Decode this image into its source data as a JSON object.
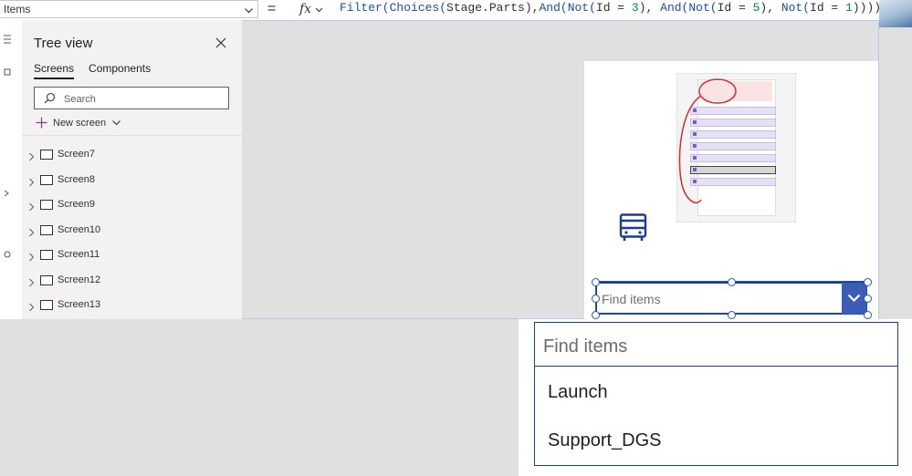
{
  "formula_bar": {
    "property": "Items",
    "equals": "=",
    "fx_label": "fx",
    "formula_tokens": [
      {
        "text": "Filter(",
        "kind": "kw"
      },
      {
        "text": "Choices(",
        "kind": "kw"
      },
      {
        "text": "Stage.Parts",
        "kind": "plain"
      },
      {
        "text": "),",
        "kind": "plain"
      },
      {
        "text": "And(",
        "kind": "kw"
      },
      {
        "text": "Not(",
        "kind": "kw"
      },
      {
        "text": "Id = ",
        "kind": "plain"
      },
      {
        "text": "3",
        "kind": "num"
      },
      {
        "text": "), ",
        "kind": "plain"
      },
      {
        "text": "And(",
        "kind": "kw"
      },
      {
        "text": "Not(",
        "kind": "kw"
      },
      {
        "text": "Id = ",
        "kind": "plain"
      },
      {
        "text": "5",
        "kind": "num"
      },
      {
        "text": "), ",
        "kind": "plain"
      },
      {
        "text": "Not(",
        "kind": "kw"
      },
      {
        "text": "Id = ",
        "kind": "plain"
      },
      {
        "text": "1",
        "kind": "num"
      },
      {
        "text": "))))",
        "kind": "plain"
      }
    ]
  },
  "tree_view": {
    "title": "Tree view",
    "tabs": [
      {
        "label": "Screens",
        "active": true
      },
      {
        "label": "Components",
        "active": false
      }
    ],
    "search_placeholder": "Search",
    "new_screen_label": "New screen",
    "screens": [
      "Screen7",
      "Screen8",
      "Screen9",
      "Screen10",
      "Screen11",
      "Screen12",
      "Screen13"
    ]
  },
  "canvas": {
    "combo_box": {
      "placeholder": "Find items"
    },
    "dropdown": {
      "search_placeholder": "Find items",
      "items": [
        "Launch",
        "Support_DGS"
      ]
    }
  },
  "colors": {
    "accent": "#3b5db8",
    "selection": "#1b56c2",
    "combo_border": "#1b3c96",
    "formula_keyword": "#1a4db8"
  },
  "icons": {
    "property_chevron": "chevron-down-icon",
    "fx": "function-icon",
    "close": "close-icon",
    "search": "search-icon",
    "add": "plus-icon",
    "expand": "chevron-right-icon",
    "screen": "screen-icon",
    "bus": "bus-icon",
    "combo_chevron": "chevron-down-icon"
  }
}
